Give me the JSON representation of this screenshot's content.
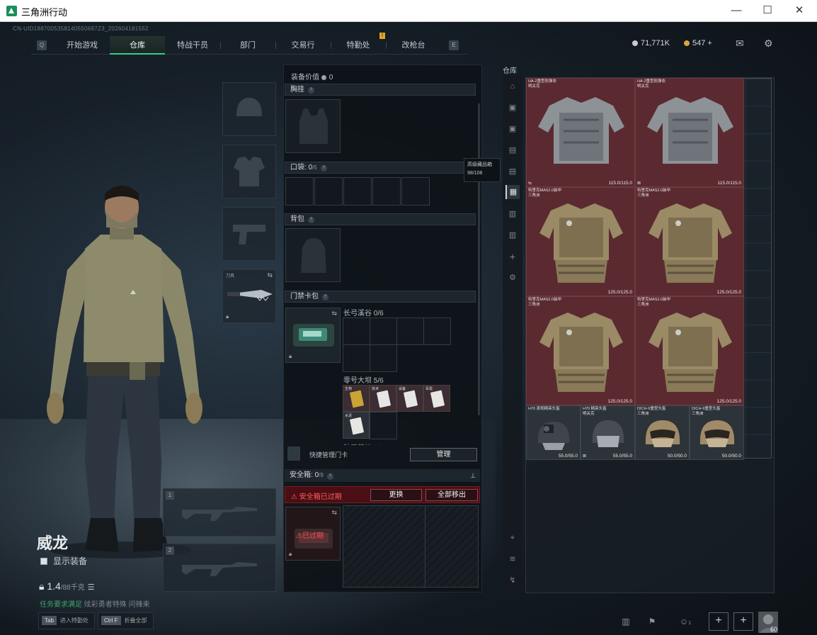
{
  "window": {
    "title": "三角洲行动",
    "minimize": "—",
    "maximize": "☐",
    "close": "✕"
  },
  "uid": "CN-UID1887005358140550697Z3_202604181552",
  "nav": {
    "left_key": "Q",
    "right_key": "E",
    "tabs": [
      "开始游戏",
      "仓库",
      "特战干员",
      "部门",
      "交易行",
      "特勤处",
      "改枪台"
    ],
    "active": 1,
    "alert": "!"
  },
  "currency": {
    "silver": "71,771K",
    "gold": "547",
    "gold_plus": "+"
  },
  "operator": {
    "name": "威龙",
    "show_equip": "显示装备",
    "weight": "1.4",
    "weight_max": "/88千克",
    "status_green": "任务要求满足",
    "status_gray": "炫彩勇者特殊  问辣来"
  },
  "hints": [
    {
      "key": "Tab",
      "label": "进入特勤处"
    },
    {
      "key": "Ctrl  F",
      "label": "折叠全部"
    }
  ],
  "equip_slots": {
    "knife_label": "刀具",
    "weapon1_num": "1",
    "weapon2_num": "2"
  },
  "equip_panel": {
    "value_label": "装备价值",
    "value": "0",
    "chest": "胸挂",
    "pocket": "口袋:",
    "pocket_count": "0",
    "pocket_max": "/5",
    "backpack": "背包",
    "keycard": "门禁卡包",
    "map1": "长弓溪谷 0/6",
    "map2": "零号大坝 5/6",
    "map3": "航天基地 0/6",
    "card_caps": [
      "生物",
      "技术",
      "设备",
      "军需",
      "水泥"
    ],
    "quick_label": "快捷管理门卡",
    "manage": "管理",
    "safe": "安全箱:",
    "safe_count": "0",
    "safe_max": "/9",
    "safe_expired": "安全箱已过期",
    "replace": "更换",
    "move_all": "全部移出",
    "safe_expired_stamp": "已过期"
  },
  "tooltip": {
    "line1": "高级藏品箱",
    "line2": "98/108"
  },
  "warehouse": {
    "label": "仓库",
    "items": [
      {
        "name": "HA-2重型防弹衣",
        "sub": "明关克",
        "durability": "115.0/115.0"
      },
      {
        "name": "HA-2重型防弹衣",
        "sub": "明关克",
        "durability": "115.0/115.0"
      },
      {
        "name": "特里克MAS2.0装甲",
        "sub": "三角洲",
        "durability": "125.0/125.0"
      },
      {
        "name": "特里克MAS2.0装甲",
        "sub": "三角洲",
        "durability": "125.0/125.0"
      },
      {
        "name": "特里克MAS2.0装甲",
        "sub": "三角洲",
        "durability": "125.0/125.0"
      },
      {
        "name": "特里克MAS2.0装甲",
        "sub": "三角洲",
        "durability": "125.0/125.0"
      },
      {
        "name": "H70 夜视精英头盔",
        "sub": "",
        "durability": "55.0/55.0"
      },
      {
        "name": "H70 精英头盔",
        "sub": "明关克",
        "durability": "55.0/55.0"
      },
      {
        "name": "DICH-9重型头盔",
        "sub": "三角洲",
        "durability": "50.0/50.0"
      },
      {
        "name": "DICH-9重型头盔",
        "sub": "三角洲",
        "durability": "50.0/50.0"
      }
    ]
  },
  "party": {
    "count": "1",
    "level": "60"
  }
}
